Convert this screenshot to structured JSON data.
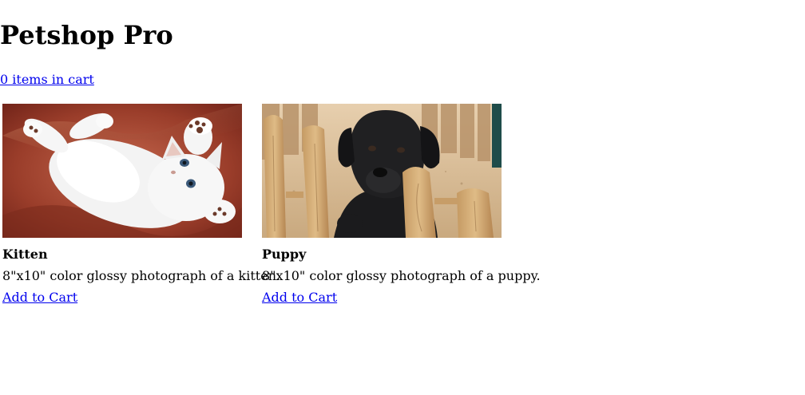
{
  "header": {
    "title": "Petshop Pro",
    "cart_link": "0 items in cart"
  },
  "products": [
    {
      "name": "Kitten",
      "description": "8\"x10\" color glossy photograph of a kitten.",
      "add_label": "Add to Cart"
    },
    {
      "name": "Puppy",
      "description": "8\"x10\" color glossy photograph of a puppy.",
      "add_label": "Add to Cart"
    }
  ],
  "colors": {
    "link": "#0000ee",
    "text": "#000000",
    "background": "#ffffff"
  }
}
